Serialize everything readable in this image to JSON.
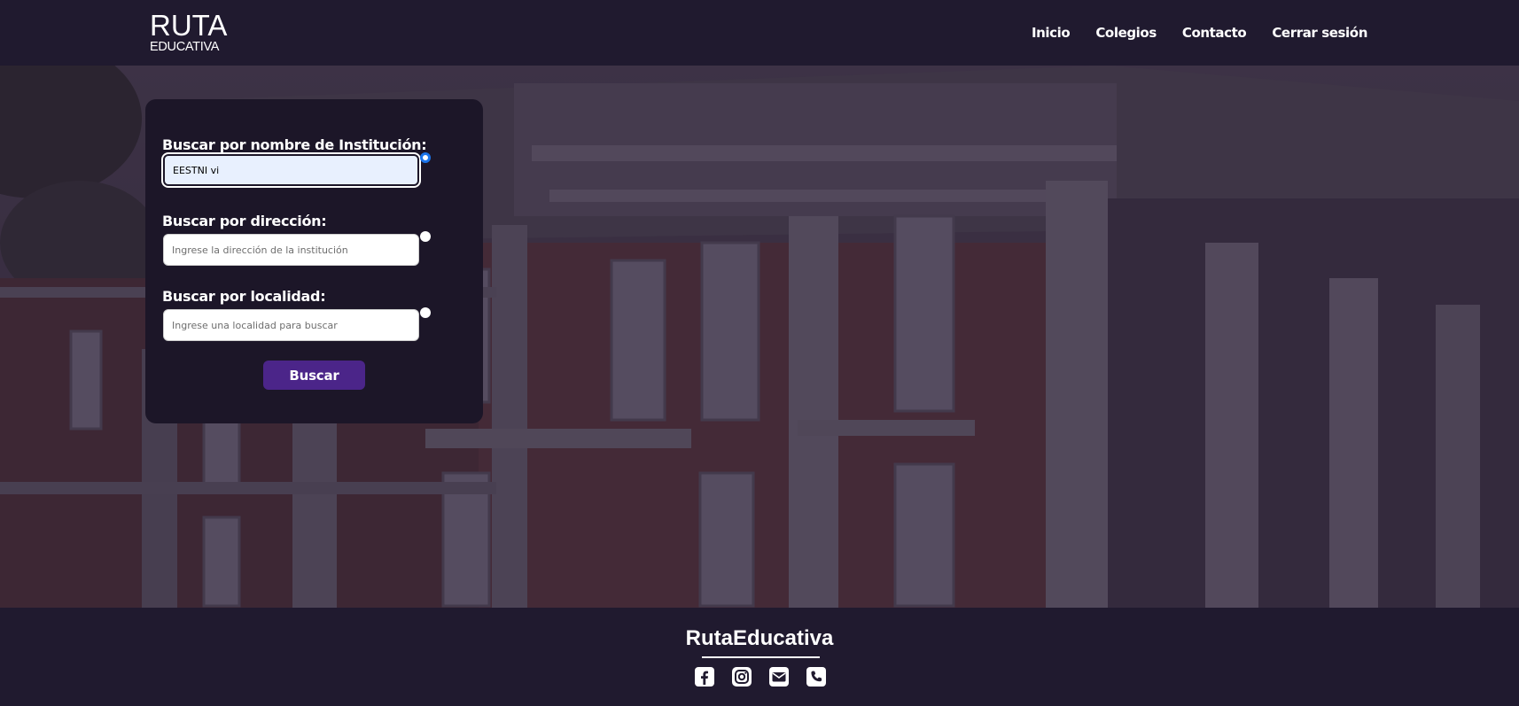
{
  "brand": {
    "logo_top": "RUTA",
    "logo_bottom": "EDUCATIVA"
  },
  "nav": {
    "items": [
      {
        "label": "Inicio"
      },
      {
        "label": "Colegios"
      },
      {
        "label": "Contacto"
      },
      {
        "label": "Cerrar sesión"
      }
    ]
  },
  "search": {
    "name_label": "Buscar por nombre de Institución:",
    "name_value": "EESTNI vi",
    "address_label": "Buscar por dirección:",
    "address_placeholder": "Ingrese la dirección de la institución",
    "locality_label": "Buscar por localidad:",
    "locality_placeholder": "Ingrese una localidad para buscar",
    "button_label": "Buscar",
    "selected_mode": "name"
  },
  "footer": {
    "brand": "RutaEducativa",
    "social": [
      {
        "icon": "facebook-icon"
      },
      {
        "icon": "instagram-icon"
      },
      {
        "icon": "mail-icon"
      },
      {
        "icon": "phone-icon"
      }
    ]
  },
  "colors": {
    "header_bg": "#201a2f",
    "card_bg": "#1c1628",
    "button_bg": "#4b2589",
    "radio_checked": "#1a73e8"
  }
}
